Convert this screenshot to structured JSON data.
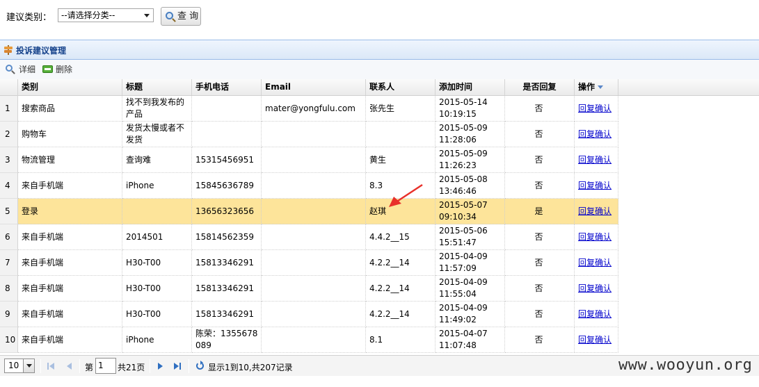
{
  "search": {
    "label": "建议类别：",
    "category_value": "--请选择分类--",
    "query_label": "查 询"
  },
  "panel": {
    "title": "投诉建议管理",
    "toolbar": {
      "detail_label": "详细",
      "delete_label": "删除"
    }
  },
  "grid": {
    "columns": {
      "category": "类别",
      "title": "标题",
      "phone": "手机电话",
      "email": "Email",
      "contact": "联系人",
      "added_time": "添加时间",
      "replied": "是否回复",
      "action": "操作"
    },
    "rows": [
      {
        "num": "1",
        "category": "搜索商品",
        "title": "找不到我发布的产品",
        "phone": "",
        "email": "mater@yongfulu.com",
        "contact": "张先生",
        "date": "2015-05-14",
        "time": "10:19:15",
        "replied": "否",
        "action": "回复确认"
      },
      {
        "num": "2",
        "category": "购物车",
        "title": "发货太慢或者不发货",
        "phone": "",
        "email": "",
        "contact": "",
        "date": "2015-05-09",
        "time": "11:28:06",
        "replied": "否",
        "action": "回复确认"
      },
      {
        "num": "3",
        "category": "物流管理",
        "title": "查询难",
        "phone": "15315456951",
        "email": "",
        "contact": "黄生",
        "date": "2015-05-09",
        "time": "11:26:23",
        "replied": "否",
        "action": "回复确认"
      },
      {
        "num": "4",
        "category": "来自手机端",
        "title": "iPhone",
        "phone": "15845636789",
        "email": "",
        "contact": "8.3",
        "date": "2015-05-08",
        "time": "13:46:46",
        "replied": "否",
        "action": "回复确认"
      },
      {
        "num": "5",
        "category": "登录",
        "title": "",
        "phone": "13656323656",
        "email": "",
        "contact": "赵琪",
        "date": "2015-05-07",
        "time": "09:10:34",
        "replied": "是",
        "action": "回复确认"
      },
      {
        "num": "6",
        "category": "来自手机端",
        "title": "2014501",
        "phone": "15814562359",
        "email": "",
        "contact": "4.4.2__15",
        "date": "2015-05-06",
        "time": "15:51:47",
        "replied": "否",
        "action": "回复确认"
      },
      {
        "num": "7",
        "category": "来自手机端",
        "title": "H30-T00",
        "phone": "15813346291",
        "email": "",
        "contact": "4.2.2__14",
        "date": "2015-04-09",
        "time": "11:57:09",
        "replied": "否",
        "action": "回复确认"
      },
      {
        "num": "8",
        "category": "来自手机端",
        "title": "H30-T00",
        "phone": "15813346291",
        "email": "",
        "contact": "4.2.2__14",
        "date": "2015-04-09",
        "time": "11:55:04",
        "replied": "否",
        "action": "回复确认"
      },
      {
        "num": "9",
        "category": "来自手机端",
        "title": "H30-T00",
        "phone": "15813346291",
        "email": "",
        "contact": "4.2.2__14",
        "date": "2015-04-09",
        "time": "11:49:02",
        "replied": "否",
        "action": "回复确认"
      },
      {
        "num": "10",
        "category": "来自手机端",
        "title": "iPhone",
        "phone": "陈荣：1355678089",
        "email": "",
        "contact": "8.1",
        "date": "2015-04-07",
        "time": "11:07:48",
        "replied": "否",
        "action": "回复确认"
      }
    ],
    "highlight_row": "5"
  },
  "pager": {
    "page_size": "10",
    "page_prefix": "第",
    "page_value": "1",
    "total_pages": "共21页",
    "summary": "显示1到10,共207记录"
  },
  "watermark": "www.wooyun.org",
  "colors": {
    "highlight": "#fde49a",
    "link": "#0000cc",
    "panel_title": "#15428b",
    "annotation": "#e8302a"
  }
}
